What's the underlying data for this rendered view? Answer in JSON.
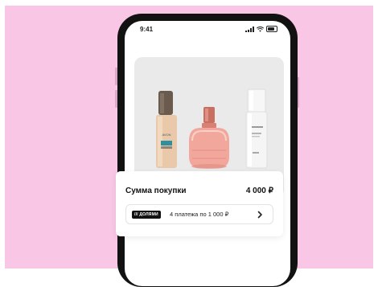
{
  "status_bar": {
    "time": "9:41",
    "icons": [
      "signal-icon",
      "wifi-icon",
      "battery-icon"
    ]
  },
  "product_image": {
    "items": [
      "foundation-bottle",
      "perfume-bottle",
      "serum-bottle"
    ]
  },
  "purchase": {
    "sum_label": "Сумма покупки",
    "sum_value": "4 000 ₽",
    "badge": "/// ДОЛЯМИ",
    "installment_text": "4 платежа по 1 000 ₽",
    "chevron": "chevron-right-icon"
  },
  "colors": {
    "background": "#f9c6e6",
    "phone_frame": "#121212",
    "card_bg": "#eaeaea",
    "badge_bg": "#111111"
  }
}
